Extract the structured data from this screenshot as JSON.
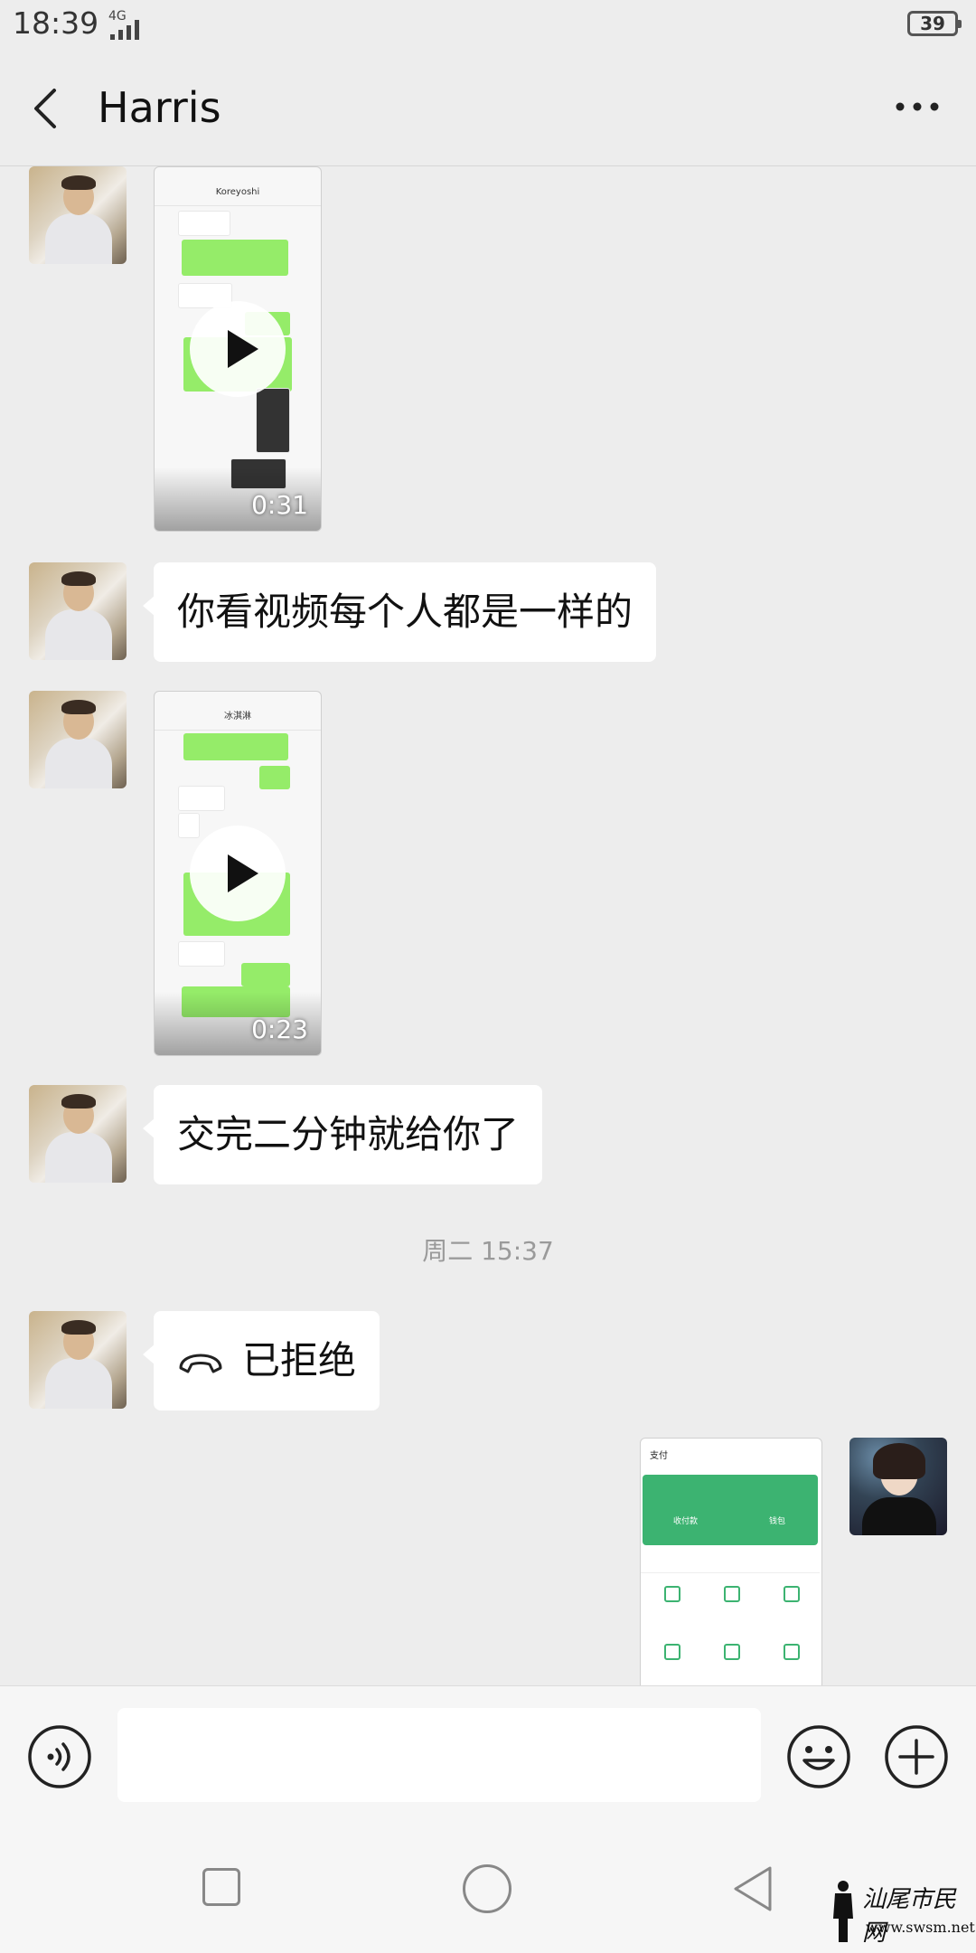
{
  "status_bar": {
    "time": "18:39",
    "network": "4G",
    "battery": "39"
  },
  "header": {
    "title": "Harris",
    "back_icon": "chevron-left-icon",
    "more_icon": "more-horizontal-icon"
  },
  "messages": [
    {
      "type": "video",
      "from": "Harris",
      "duration": "0:31",
      "preview_title": "Koreyoshi"
    },
    {
      "type": "text",
      "from": "Harris",
      "text": "你看视频每个人都是一样的"
    },
    {
      "type": "video",
      "from": "Harris",
      "duration": "0:23",
      "preview_title": "冰淇淋"
    },
    {
      "type": "text",
      "from": "Harris",
      "text": "交完二分钟就给你了"
    },
    {
      "type": "time",
      "text": "周二 15:37"
    },
    {
      "type": "call",
      "from": "Harris",
      "text": "已拒绝",
      "icon": "hang-up-phone-icon"
    },
    {
      "type": "image",
      "from": "me",
      "preview_title": "支付",
      "preview_items": [
        "收付款",
        "钱包"
      ]
    }
  ],
  "input_bar": {
    "placeholder": "",
    "voice_icon": "voice-icon",
    "emoji_icon": "emoji-icon",
    "plus_icon": "plus-icon"
  },
  "system_nav": {
    "recent_icon": "square-icon",
    "home_icon": "circle-icon",
    "back_icon": "triangle-back-icon"
  },
  "watermark": {
    "title": "汕尾市民网",
    "url": "www.swsm.net"
  },
  "colors": {
    "background": "#ededed",
    "bubble_in": "#ffffff",
    "bubble_out": "#95ec69",
    "pay_green": "#3cb371"
  }
}
